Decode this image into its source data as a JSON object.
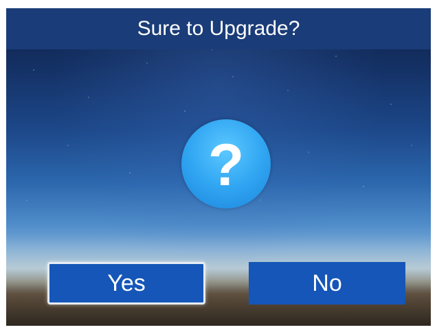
{
  "dialog": {
    "title": "Sure to Upgrade?",
    "icon": "question-icon",
    "icon_glyph": "?",
    "buttons": {
      "yes_label": "Yes",
      "no_label": "No"
    }
  },
  "colors": {
    "title_bar": "#1a3c78",
    "button": "#1556b8",
    "icon": "#31a6f2",
    "focus_border": "#e6ecf5"
  }
}
